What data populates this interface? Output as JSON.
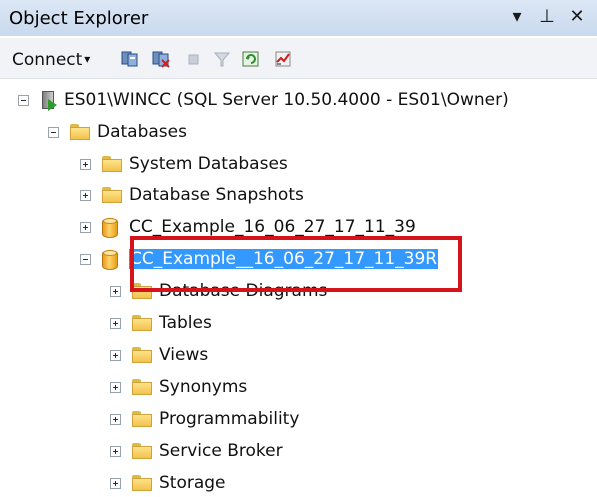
{
  "window": {
    "title": "Object Explorer",
    "buttons": {
      "dropdown": "▾",
      "pin": "⊥",
      "close": "✕"
    }
  },
  "toolbar": {
    "connect_label": "Connect",
    "connect_arrow": "▾"
  },
  "tree": {
    "server_label": "ES01\\WINCC (SQL Server 10.50.4000 - ES01\\Owner)",
    "databases_label": "Databases",
    "system_databases_label": "System Databases",
    "database_snapshots_label": "Database Snapshots",
    "db1_label": "CC_Example_16_06_27_17_11_39",
    "db2_label": "CC_Example__16_06_27_17_11_39R",
    "children": {
      "database_diagrams": "Database Diagrams",
      "tables": "Tables",
      "views": "Views",
      "synonyms": "Synonyms",
      "programmability": "Programmability",
      "service_broker": "Service Broker",
      "storage": "Storage"
    }
  },
  "colors": {
    "selection": "#3399ff",
    "highlight": "#d4141a",
    "titlebar": "#c9d9ee"
  }
}
